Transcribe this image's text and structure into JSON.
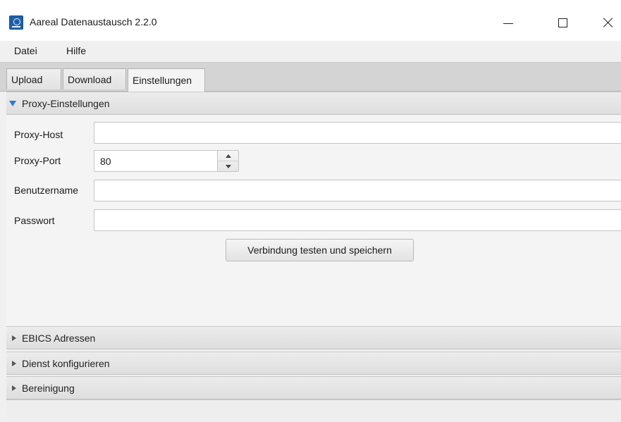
{
  "window": {
    "title": "Aareal Datenaustausch 2.2.0",
    "icon": "app-icon",
    "controls": {
      "minimize": "minimize-icon",
      "maximize": "maximize-icon",
      "close": "close-icon"
    }
  },
  "menubar": {
    "items": [
      {
        "label": "Datei"
      },
      {
        "label": "Hilfe"
      }
    ]
  },
  "tabs": [
    {
      "label": "Upload",
      "selected": false
    },
    {
      "label": "Download",
      "selected": false
    },
    {
      "label": "Einstellungen",
      "selected": true
    }
  ],
  "proxy": {
    "header": "Proxy-Einstellungen",
    "expanded": true,
    "host": {
      "label": "Proxy-Host",
      "value": ""
    },
    "port": {
      "label": "Proxy-Port",
      "value": "80"
    },
    "user": {
      "label": "Benutzername",
      "value": ""
    },
    "password": {
      "label": "Passwort",
      "value": ""
    },
    "test_button": "Verbindung testen und speichern"
  },
  "sections": [
    {
      "label": "EBICS Adressen",
      "expanded": false
    },
    {
      "label": "Dienst konfigurieren",
      "expanded": false
    },
    {
      "label": "Bereinigung",
      "expanded": false
    }
  ],
  "colors": {
    "accent_arrow": "#2a7bd6",
    "window_bg": "#f0f0f0",
    "tabbar_bg": "#d4d4d4"
  }
}
